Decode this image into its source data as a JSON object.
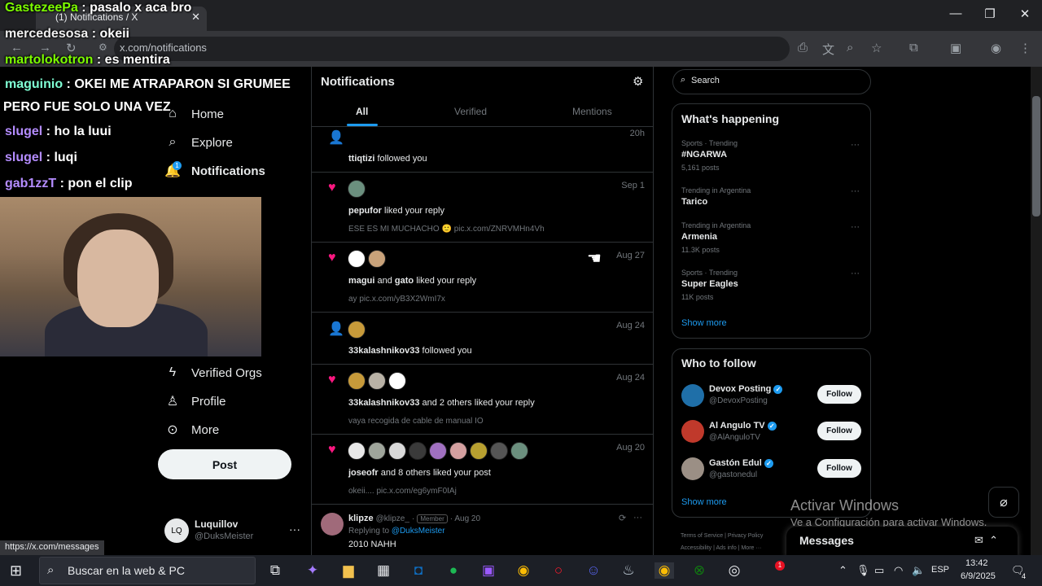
{
  "browser": {
    "tab_title": "(1) Notifications / X",
    "url": "x.com/notifications",
    "status_url": "https://x.com/messages"
  },
  "chat": [
    {
      "user": "GastezeePa",
      "sep": " : ",
      "msg": "pasalo x aca bro",
      "color": "#7CFC00"
    },
    {
      "user": "mercedesosa",
      "sep": " : ",
      "msg": "okeii",
      "color": "#f0f0f0"
    },
    {
      "user": "martolokotron",
      "sep": " : ",
      "msg": "es mentira",
      "color": "#7CFC00"
    },
    {
      "user": "maguinio",
      "sep": " : ",
      "msg": "OKEI ME ATRAPARON SI GRUMEE",
      "color": "#7FFFD4"
    },
    {
      "user": "",
      "sep": "",
      "msg": "PERO FUE SOLO UNA VEZ",
      "color": "#fff"
    },
    {
      "user": "slugel",
      "sep": " : ",
      "msg": "ho la luui",
      "color": "#b48cff"
    },
    {
      "user": "slugel",
      "sep": " : ",
      "msg": "luqi",
      "color": "#b48cff"
    },
    {
      "user": "gab1zzT",
      "sep": " : ",
      "msg": "pon el clip",
      "color": "#b48cff"
    }
  ],
  "nav": {
    "home": "Home",
    "explore": "Explore",
    "notifications": "Notifications",
    "notif_badge": "1",
    "verified_orgs": "Verified Orgs",
    "profile": "Profile",
    "more": "More",
    "post": "Post"
  },
  "account": {
    "name": "Luquillov",
    "handle": "@DuksMeister",
    "avatar": "LQ"
  },
  "feed": {
    "title": "Notifications",
    "tabs": {
      "all": "All",
      "verified": "Verified",
      "mentions": "Mentions"
    },
    "rows": [
      {
        "date": "20h",
        "actor": "ttiqtizi",
        "action": "followed you",
        "sub": ""
      },
      {
        "date": "Sep 1",
        "actor": "pepufor",
        "action": "liked your reply",
        "sub": "ESE ES MI MUCHACHO 🙂 pic.x.com/ZNRVMHn4Vh"
      },
      {
        "date": "Aug 27",
        "actor": "magui",
        "mid": "and",
        "actor2": "gato",
        "action": "liked your reply",
        "sub": "ay pic.x.com/yB3X2WmI7x"
      },
      {
        "date": "Aug 24",
        "actor": "33kalashnikov33",
        "action": "followed you",
        "sub": ""
      },
      {
        "date": "Aug 24",
        "actor": "33kalashnikov33",
        "action": "and 2 others liked your reply",
        "sub": "vaya recogida de cable de manual IO"
      },
      {
        "date": "Aug 20",
        "actor": "joseofr",
        "action": "and 8 others liked your post",
        "sub": "okeii.... pic.x.com/eg6ymF0IAj"
      }
    ],
    "reply": {
      "name": "klipze",
      "handle": "@klipze_",
      "dot": "·",
      "badge": "Member",
      "date": "· Aug 20",
      "replying": "Replying to",
      "replying_to": "@DuksMeister",
      "text": "2010 NAHH"
    }
  },
  "sidebar": {
    "search_placeholder": "Search",
    "whats_happening": "What's happening",
    "trends": [
      {
        "meta": "Sports · Trending",
        "name": "#NGARWA",
        "count": "5,161 posts"
      },
      {
        "meta": "Trending in Argentina",
        "name": "Tarico",
        "count": ""
      },
      {
        "meta": "Trending in Argentina",
        "name": "Armenia",
        "count": "11.3K posts"
      },
      {
        "meta": "Sports · Trending",
        "name": "Super Eagles",
        "count": "11K posts"
      }
    ],
    "show_more": "Show more",
    "who_to_follow": "Who to follow",
    "follow_suggestions": [
      {
        "name": "Devox Posting",
        "handle": "@DevoxPosting",
        "color": "#1f6fa8"
      },
      {
        "name": "Al Angulo TV",
        "handle": "@AlAnguloTV",
        "color": "#c0392b"
      },
      {
        "name": "Gastón Edul",
        "handle": "@gastonedul",
        "color": "#9b8f85"
      }
    ],
    "follow_label": "Follow",
    "show_more2": "Show more",
    "footer": {
      "terms": "Terms of Service",
      "privacy": "Privacy Policy",
      "accessibility": "Accessibility",
      "ads": "Ads info",
      "more": "More ···"
    },
    "messages": "Messages"
  },
  "windows": {
    "activate_title": "Activar Windows",
    "activate_sub": "Ve a Configuración para activar Windows.",
    "search_placeholder": "Buscar en la web & PC",
    "lang": "ESP",
    "time": "13:42",
    "date": "6/9/2025",
    "notif_count": "1",
    "action_center_count": "4"
  },
  "colors": {
    "accent": "#1d9bf0",
    "like": "#f91880",
    "bg": "#000000"
  }
}
